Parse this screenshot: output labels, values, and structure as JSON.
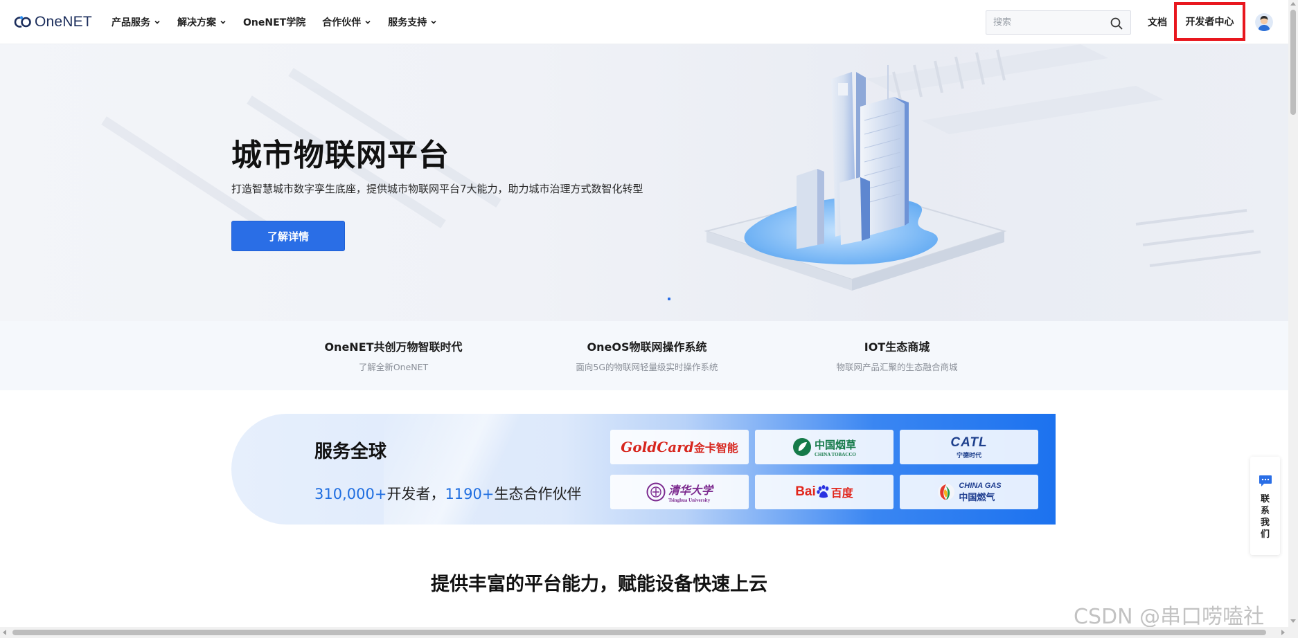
{
  "header": {
    "logo_text": "OneNET",
    "nav": [
      {
        "label": "产品服务",
        "has_dropdown": true
      },
      {
        "label": "解决方案",
        "has_dropdown": true
      },
      {
        "label": "OneNET学院",
        "has_dropdown": false
      },
      {
        "label": "合作伙伴",
        "has_dropdown": true
      },
      {
        "label": "服务支持",
        "has_dropdown": true
      }
    ],
    "search": {
      "placeholder": "搜索",
      "value": ""
    },
    "docs_label": "文档",
    "dev_center_label": "开发者中心",
    "annotation_marker": "①"
  },
  "hero": {
    "title": "城市物联网平台",
    "subtitle": "打造智慧城市数字孪生底座，提供城市物联网平台7大能力，助力城市治理方式数智化转型",
    "button_label": "了解详情"
  },
  "quick_links": [
    {
      "title": "OneNET共创万物智联时代",
      "desc": "了解全新OneNET"
    },
    {
      "title": "OneOS物联网操作系统",
      "desc": "面向5G的物联网轻量级实时操作系统"
    },
    {
      "title": "IOT生态商城",
      "desc": "物联网产品汇聚的生态融合商城"
    }
  ],
  "global_service": {
    "title": "服务全球",
    "developers_count": "310,000+",
    "developers_label": "开发者，",
    "partners_count": "1190+",
    "partners_label": "生态合作伙伴",
    "partners": [
      {
        "name": "GoldCard金卡智能",
        "latin": "GoldCard",
        "cn": "金卡智能"
      },
      {
        "name": "中国烟草",
        "cn": "中国烟草",
        "latin": "CHINA TOBACCO"
      },
      {
        "name": "CATL宁德时代",
        "latin": "CATL",
        "cn": "宁德时代"
      },
      {
        "name": "清华大学",
        "cn": "清华大学",
        "latin": "Tsinghua University"
      },
      {
        "name": "Baidu百度",
        "latin": "Bai",
        "cn": "百度"
      },
      {
        "name": "CHINA GAS中国燃气",
        "latin": "CHINA GAS",
        "cn": "中国燃气"
      }
    ]
  },
  "section_title": "提供丰富的平台能力，赋能设备快速上云",
  "contact": {
    "label": "联系我们"
  },
  "watermark": "CSDN @串口唠嗑社",
  "colors": {
    "brand_blue": "#2a6ee6",
    "highlight_red": "#e8171e",
    "stat_blue": "#1f6ee0"
  }
}
